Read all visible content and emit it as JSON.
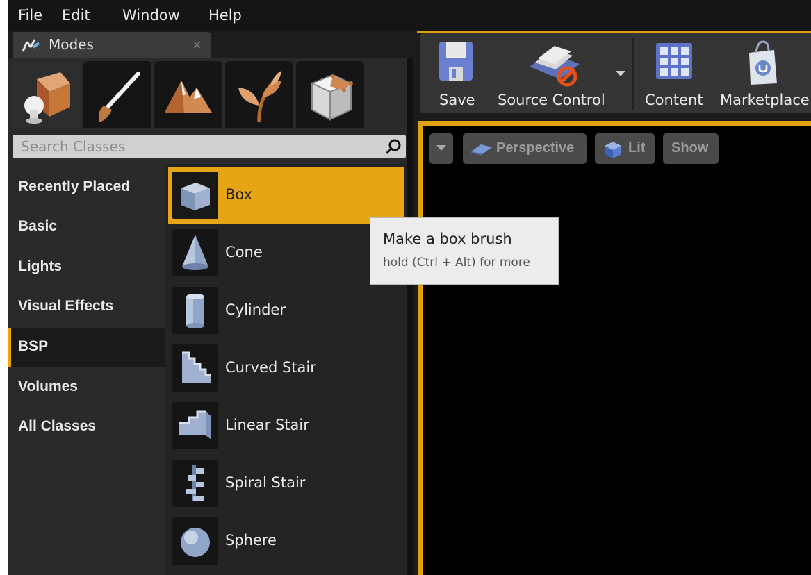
{
  "menu": [
    "File",
    "Edit",
    "Window",
    "Help"
  ],
  "modes_tab": {
    "title": "Modes",
    "close": "×"
  },
  "mode_icons": [
    "place-mode-icon",
    "paint-mode-icon",
    "landscape-mode-icon",
    "foliage-mode-icon",
    "geometry-mode-icon"
  ],
  "search": {
    "placeholder": "Search Classes"
  },
  "categories": [
    "Recently Placed",
    "Basic",
    "Lights",
    "Visual Effects",
    "BSP",
    "Volumes",
    "All Classes"
  ],
  "selected_category": "BSP",
  "items": [
    {
      "label": "Box",
      "icon": "box-brush-icon"
    },
    {
      "label": "Cone",
      "icon": "cone-brush-icon"
    },
    {
      "label": "Cylinder",
      "icon": "cylinder-brush-icon"
    },
    {
      "label": "Curved Stair",
      "icon": "curved-stair-icon"
    },
    {
      "label": "Linear Stair",
      "icon": "linear-stair-icon"
    },
    {
      "label": "Spiral Stair",
      "icon": "spiral-stair-icon"
    },
    {
      "label": "Sphere",
      "icon": "sphere-brush-icon"
    }
  ],
  "selected_item": "Box",
  "toolbar": {
    "save": "Save",
    "source_control": "Source Control",
    "content": "Content",
    "marketplace": "Marketplace"
  },
  "viewport": {
    "perspective": "Perspective",
    "lit": "Lit",
    "show": "Show"
  },
  "tooltip": {
    "title": "Make a box brush",
    "subtitle": "hold (Ctrl + Alt) for more"
  },
  "colors": {
    "accent": "#e5a514",
    "panel": "#2a2a2a",
    "viewport": "#000000"
  }
}
